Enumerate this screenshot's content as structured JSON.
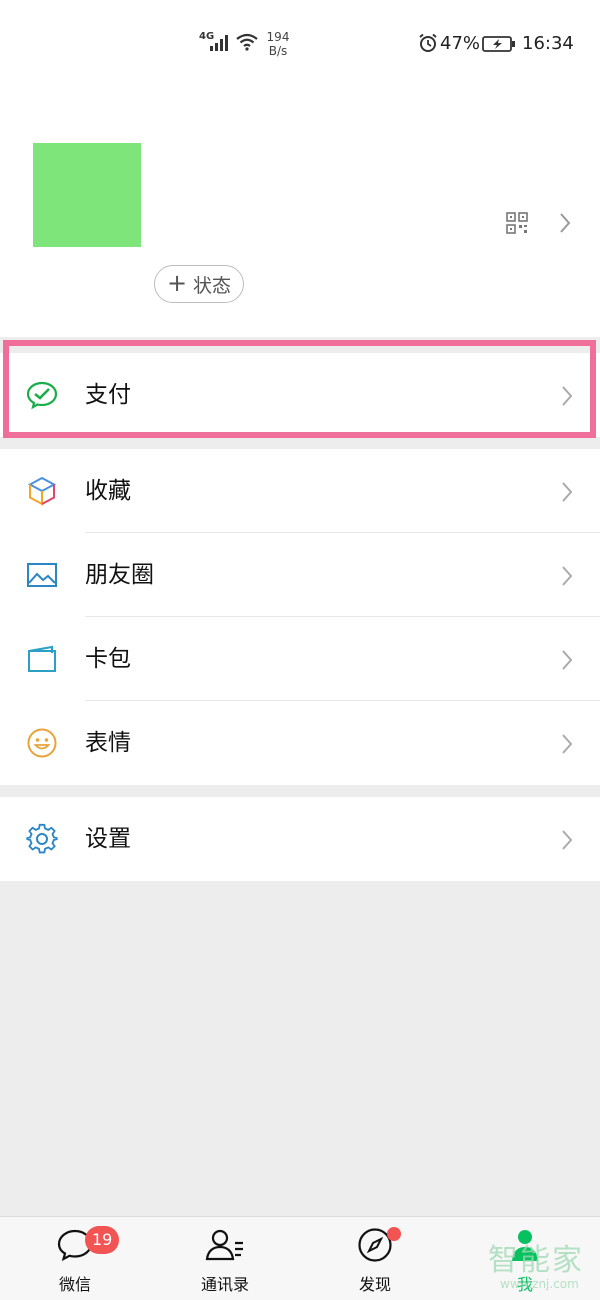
{
  "status_bar": {
    "network": "4G",
    "speed_value": "194",
    "speed_unit": "B/s",
    "battery_pct": "47%",
    "time": "16:34"
  },
  "profile": {
    "status_button_label": "状态",
    "avatar_color": "#7ee57a"
  },
  "menu": {
    "pay": "支付",
    "favorites": "收藏",
    "moments": "朋友圈",
    "cards": "卡包",
    "stickers": "表情",
    "settings": "设置"
  },
  "highlight_color": "#f06f9a",
  "tabbar": {
    "chats": "微信",
    "chats_badge": "19",
    "contacts": "通讯录",
    "discover": "发现",
    "me": "我"
  },
  "watermark": {
    "big": "智能家",
    "small": "www.znj.com"
  },
  "colors": {
    "accent_green": "#07c160",
    "badge_red": "#f25353",
    "background_gray": "#ededed"
  }
}
